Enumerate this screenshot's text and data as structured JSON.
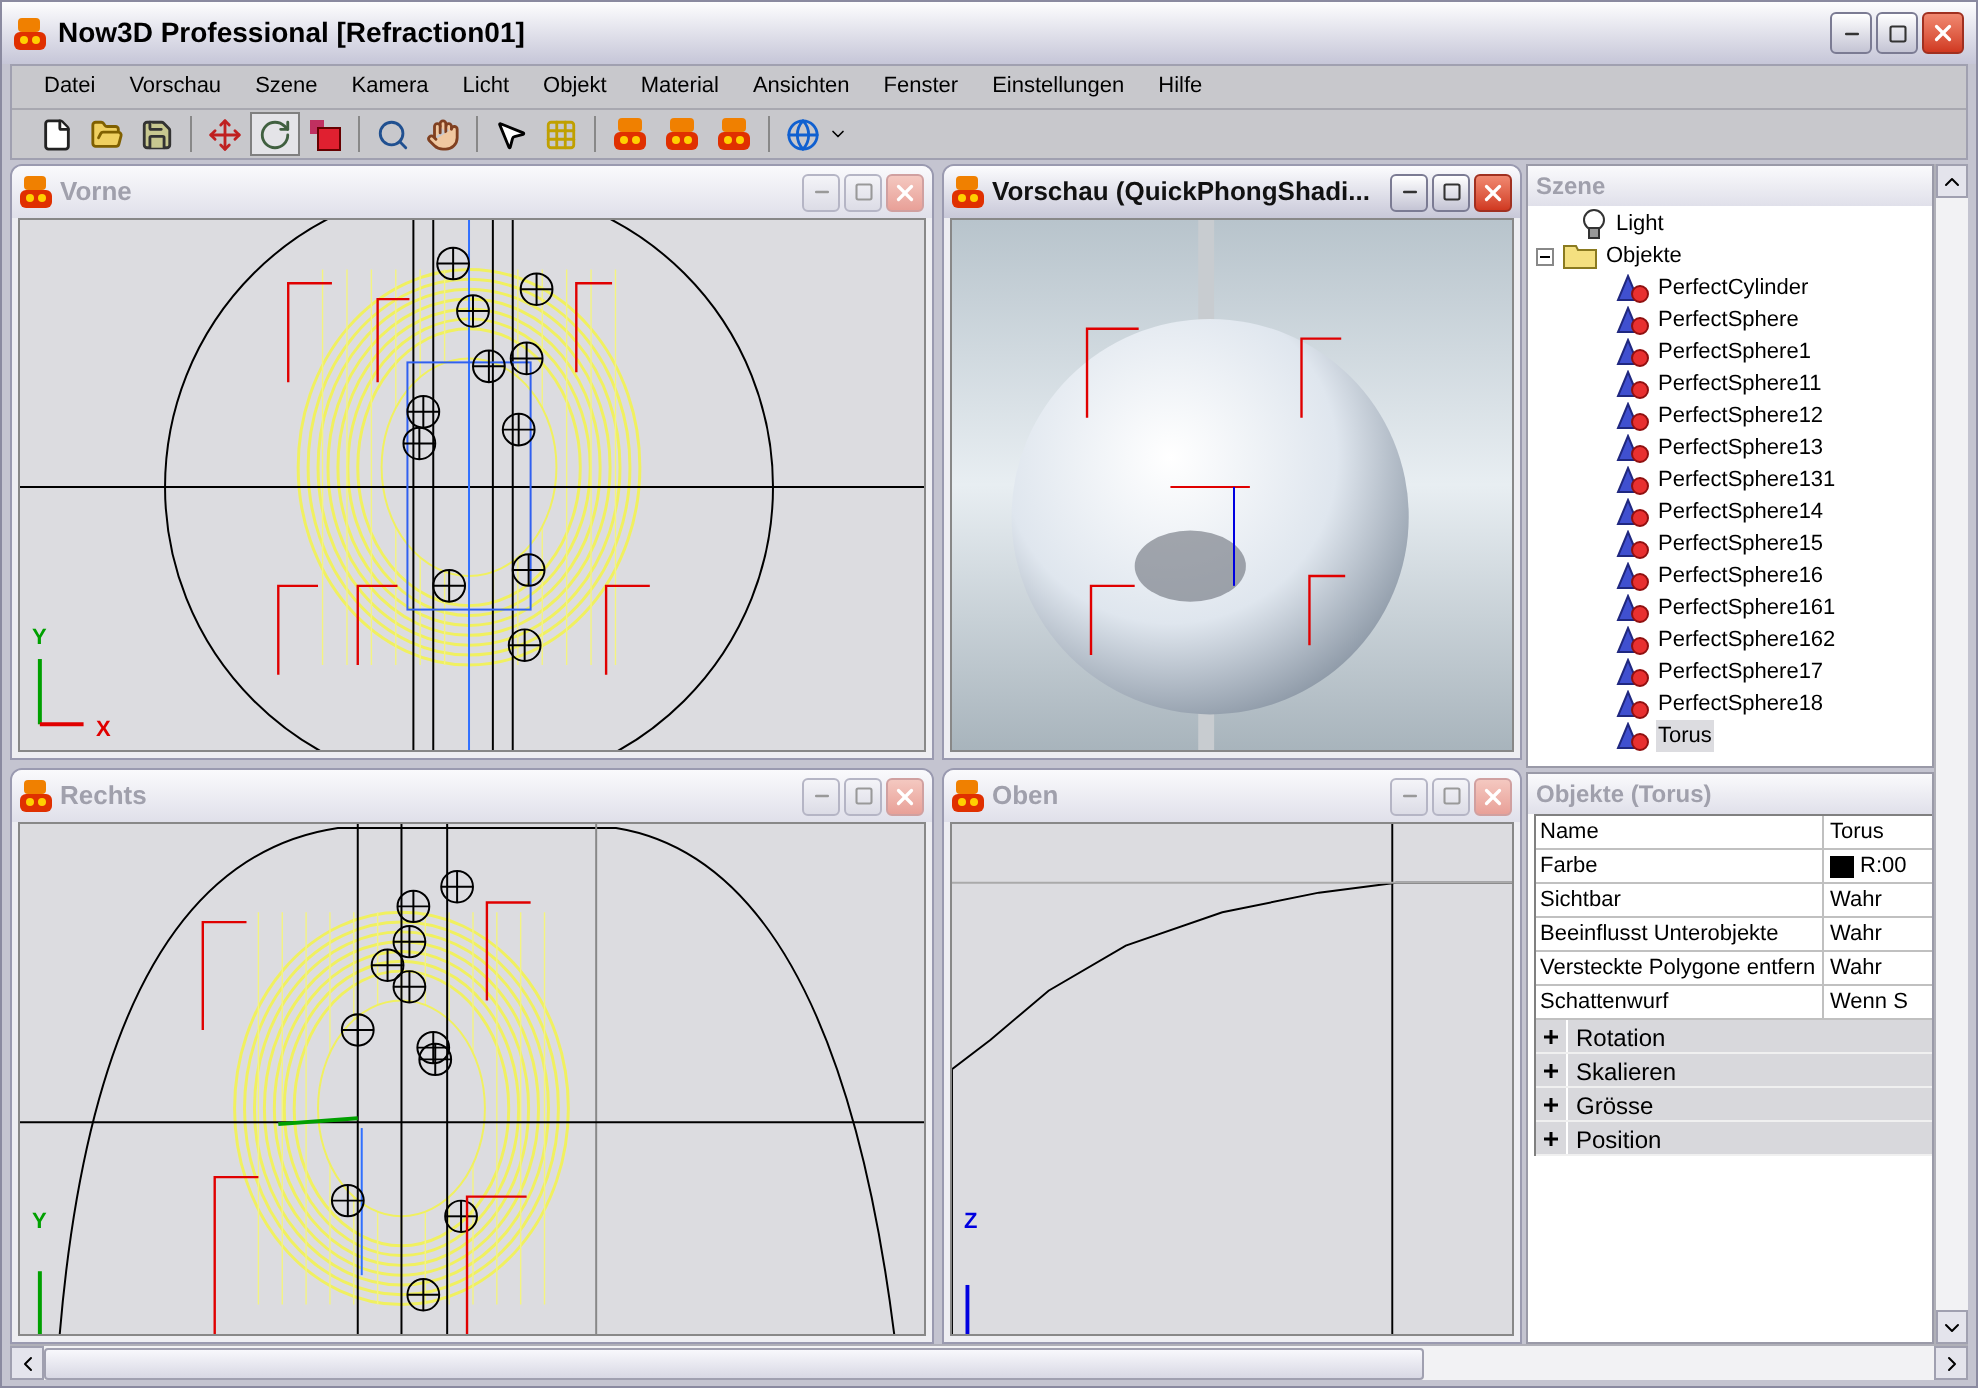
{
  "window": {
    "title": "Now3D Professional [Refraction01]"
  },
  "menu": [
    "Datei",
    "Vorschau",
    "Szene",
    "Kamera",
    "Licht",
    "Objekt",
    "Material",
    "Ansichten",
    "Fenster",
    "Einstellungen",
    "Hilfe"
  ],
  "toolbar": [
    {
      "tools": [
        {
          "kind": "new",
          "selected": false
        },
        {
          "kind": "open",
          "selected": false
        },
        {
          "kind": "save",
          "selected": false
        }
      ]
    },
    {
      "tools": [
        {
          "kind": "move",
          "selected": false
        },
        {
          "kind": "rotate",
          "selected": true
        },
        {
          "kind": "scale",
          "selected": false
        }
      ]
    },
    {
      "tools": [
        {
          "kind": "zoom",
          "selected": false
        },
        {
          "kind": "pan",
          "selected": false
        }
      ]
    },
    {
      "tools": [
        {
          "kind": "pointer",
          "selected": false
        },
        {
          "kind": "select-points",
          "selected": false
        }
      ]
    },
    {
      "tools": [
        {
          "kind": "render",
          "selected": false
        },
        {
          "kind": "render",
          "selected": false
        },
        {
          "kind": "render",
          "selected": false
        }
      ]
    },
    {
      "tools": [
        {
          "kind": "web",
          "selected": false
        }
      ]
    }
  ],
  "viewports": [
    {
      "title": "Vorne",
      "active": false,
      "kind": "front",
      "axes": [
        {
          "label": "Y",
          "color": "#00a000"
        },
        {
          "label": "X",
          "color": "#e00000"
        }
      ]
    },
    {
      "title": "Vorschau (QuickPhongShadi...",
      "active": true,
      "kind": "render"
    },
    {
      "title": "Rechts",
      "active": false,
      "kind": "side",
      "axes": [
        {
          "label": "Y",
          "color": "#00a000"
        }
      ]
    },
    {
      "title": "Oben",
      "active": false,
      "kind": "top",
      "axes": [
        {
          "label": "Z",
          "color": "#0000e0"
        }
      ]
    }
  ],
  "scene": {
    "title": "Szene",
    "tree": [
      {
        "label": "Light",
        "kind": "light",
        "selected": false
      },
      {
        "label": "Objekte",
        "kind": "folder",
        "expanded": true,
        "selected": false,
        "children": [
          {
            "label": "PerfectCylinder",
            "kind": "object",
            "selected": false
          },
          {
            "label": "PerfectSphere",
            "kind": "object",
            "selected": false
          },
          {
            "label": "PerfectSphere1",
            "kind": "object",
            "selected": false
          },
          {
            "label": "PerfectSphere11",
            "kind": "object",
            "selected": false
          },
          {
            "label": "PerfectSphere12",
            "kind": "object",
            "selected": false
          },
          {
            "label": "PerfectSphere13",
            "kind": "object",
            "selected": false
          },
          {
            "label": "PerfectSphere131",
            "kind": "object",
            "selected": false
          },
          {
            "label": "PerfectSphere14",
            "kind": "object",
            "selected": false
          },
          {
            "label": "PerfectSphere15",
            "kind": "object",
            "selected": false
          },
          {
            "label": "PerfectSphere16",
            "kind": "object",
            "selected": false
          },
          {
            "label": "PerfectSphere161",
            "kind": "object",
            "selected": false
          },
          {
            "label": "PerfectSphere162",
            "kind": "object",
            "selected": false
          },
          {
            "label": "PerfectSphere17",
            "kind": "object",
            "selected": false
          },
          {
            "label": "PerfectSphere18",
            "kind": "object",
            "selected": false
          },
          {
            "label": "Torus",
            "kind": "object",
            "selected": true
          }
        ]
      }
    ]
  },
  "properties": {
    "title": "Objekte (Torus)",
    "rows": [
      {
        "name": "Name",
        "value": "Torus"
      },
      {
        "name": "Farbe",
        "value": "R:00",
        "color": "#000000"
      },
      {
        "name": "Sichtbar",
        "value": "Wahr"
      },
      {
        "name": "Beeinflusst Unterobjekte",
        "value": "Wahr"
      },
      {
        "name": "Versteckte Polygone entfern",
        "value": "Wahr"
      },
      {
        "name": "Schattenwurf",
        "value": "Wenn S"
      }
    ],
    "groups": [
      {
        "label": "Rotation",
        "expanded": false
      },
      {
        "label": "Skalieren",
        "expanded": false
      },
      {
        "label": "Grösse",
        "expanded": false
      },
      {
        "label": "Position",
        "expanded": false
      }
    ]
  }
}
